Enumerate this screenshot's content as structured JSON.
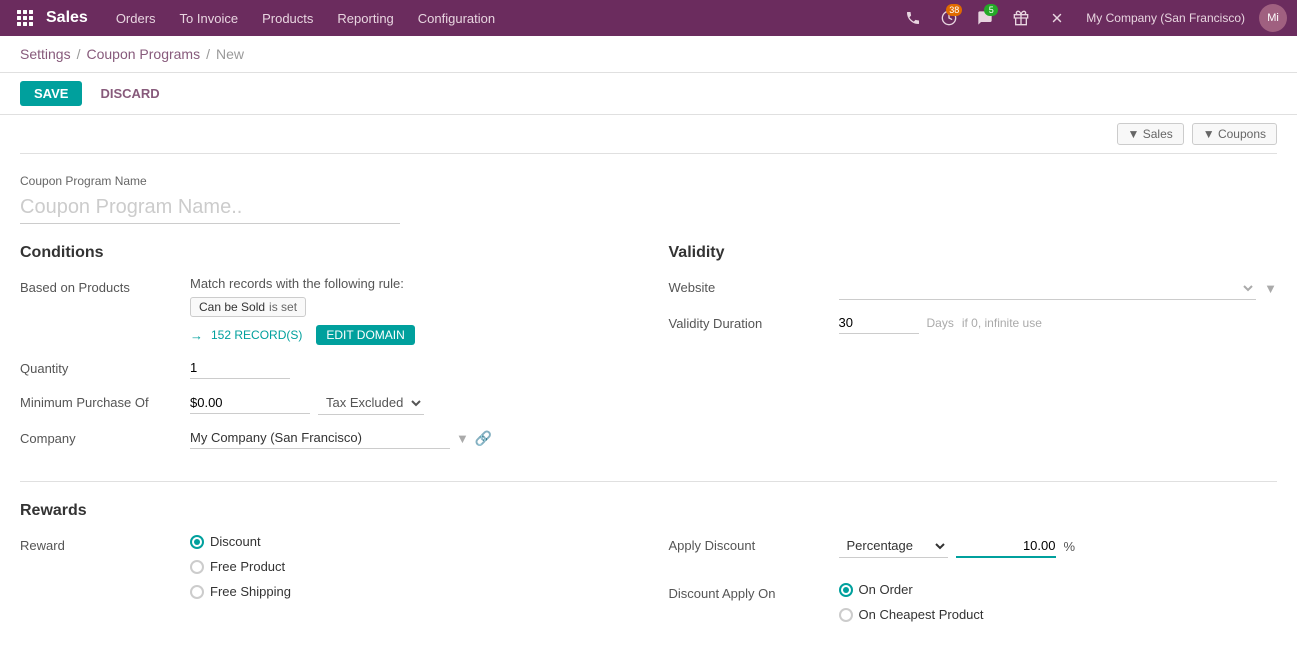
{
  "nav": {
    "brand": "Sales",
    "menu_items": [
      "Orders",
      "To Invoice",
      "Products",
      "Reporting",
      "Configuration"
    ],
    "badge_38": "38",
    "badge_5": "5",
    "company": "My Company (San Francisco)",
    "user_initials": "Mi"
  },
  "breadcrumb": {
    "settings": "Settings",
    "coupon_programs": "Coupon Programs",
    "current": "New"
  },
  "actions": {
    "save": "SAVE",
    "discard": "DISCARD"
  },
  "filters": {
    "sales_label": "▼  Sales",
    "coupons_label": "▼  Coupons"
  },
  "form": {
    "program_name_label": "Coupon Program Name",
    "program_name_placeholder": "Coupon Program Name..",
    "conditions_title": "Conditions",
    "based_on_products_label": "Based on Products",
    "match_rule_text": "Match records with the following rule:",
    "can_be_sold_tag": "Can be Sold",
    "is_set_label": "is set",
    "records_count": "152 RECORD(S)",
    "edit_domain_btn": "EDIT DOMAIN",
    "quantity_label": "Quantity",
    "quantity_value": "1",
    "min_purchase_label": "Minimum Purchase Of",
    "min_purchase_value": "$0.00",
    "tax_excluded_label": "Tax Excluded",
    "company_label": "Company",
    "company_value": "My Company (San Francisco)",
    "validity_title": "Validity",
    "website_label": "Website",
    "website_placeholder": "",
    "validity_duration_label": "Validity Duration",
    "validity_duration_value": "30",
    "validity_days": "Days",
    "validity_note": "if 0, infinite use",
    "rewards_title": "Rewards",
    "reward_label": "Reward",
    "reward_discount": "Discount",
    "reward_free_product": "Free Product",
    "reward_free_shipping": "Free Shipping",
    "apply_discount_label": "Apply Discount",
    "discount_type": "Percentage",
    "discount_value": "10.00",
    "discount_pct": "%",
    "discount_apply_on_label": "Discount Apply On",
    "on_order": "On Order",
    "on_cheapest_product": "On Cheapest Product"
  }
}
